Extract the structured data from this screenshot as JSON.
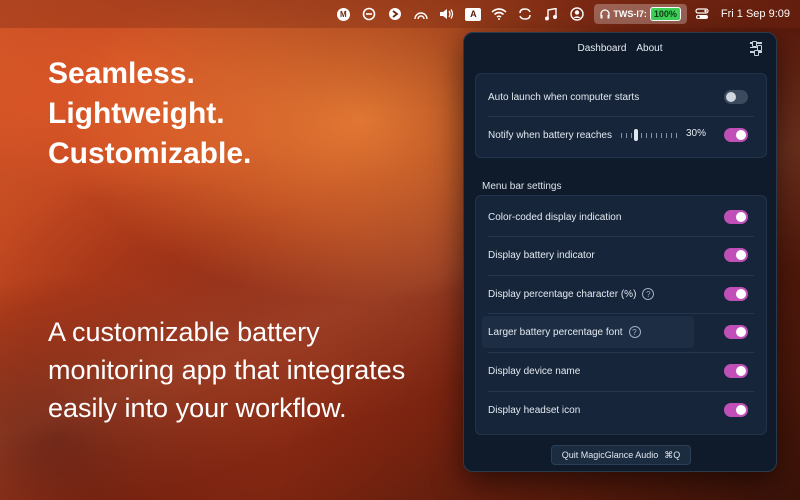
{
  "menubar": {
    "icons": [
      "m-badge-icon",
      "circle-dash-icon",
      "app-logo-icon",
      "rainbow-icon",
      "volume-icon",
      "keyboard-a-icon",
      "wifi-icon",
      "rotate-icon",
      "music-icon",
      "user-icon"
    ],
    "keyboard_label": "A",
    "m_badge_label": "M",
    "device_name": "TWS-I7:",
    "battery_pct": "100%",
    "clock": "Fri 1 Sep  9:09"
  },
  "marketing": {
    "headline": [
      "Seamless.",
      "Lightweight.",
      "Customizable."
    ],
    "tagline": "A customizable battery monitoring app that integrates easily into your workflow."
  },
  "popover": {
    "tabs": [
      "Dashboard",
      "About"
    ],
    "general": {
      "auto_launch_label": "Auto launch when computer starts",
      "auto_launch_on": false,
      "notify_label": "Notify when battery reaches",
      "notify_value": "30%",
      "notify_level": 0.3,
      "notify_on": true
    },
    "menu_bar_section_title": "Menu bar settings",
    "menu_bar_settings": [
      {
        "label": "Color-coded display indication",
        "help": false,
        "on": true
      },
      {
        "label": "Display battery indicator",
        "help": false,
        "on": true
      },
      {
        "label": "Display percentage character (%)",
        "help": true,
        "on": true
      },
      {
        "label": "Larger battery percentage font",
        "help": true,
        "on": true
      },
      {
        "label": "Display device name",
        "help": false,
        "on": true
      },
      {
        "label": "Display headset icon",
        "help": false,
        "on": true
      }
    ],
    "help_glyph": "?",
    "quit_label": "Quit MagicGlance Audio",
    "quit_shortcut": "⌘Q"
  },
  "colors": {
    "accent_toggle": "#c04fb8",
    "battery_green": "#3fd25a",
    "panel_bg": "#0f1b2a"
  }
}
